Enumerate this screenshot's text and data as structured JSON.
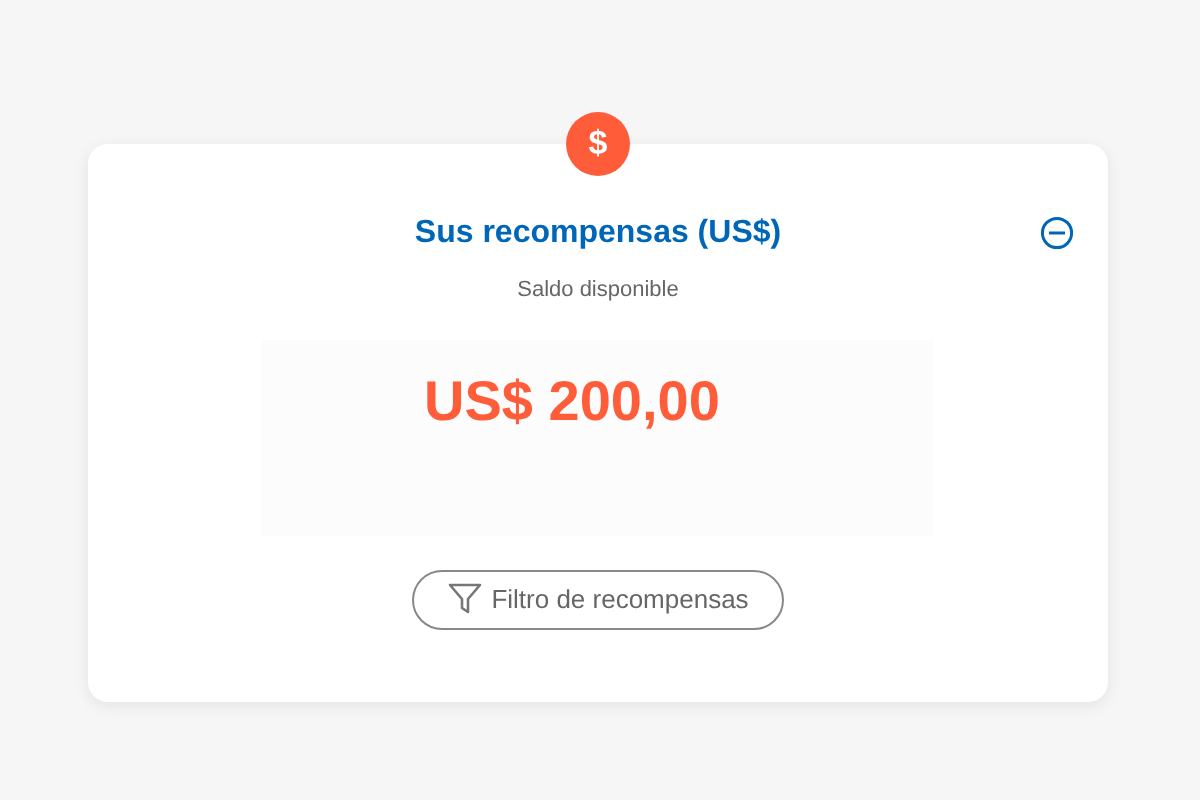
{
  "badge_symbol": "$",
  "card": {
    "title": "Sus recompensas (US$)",
    "expanded": true,
    "subtitle": "Saldo disponible",
    "amount": "US$ 200,00"
  },
  "filter_button": {
    "label": "Filtro de recompensas"
  }
}
